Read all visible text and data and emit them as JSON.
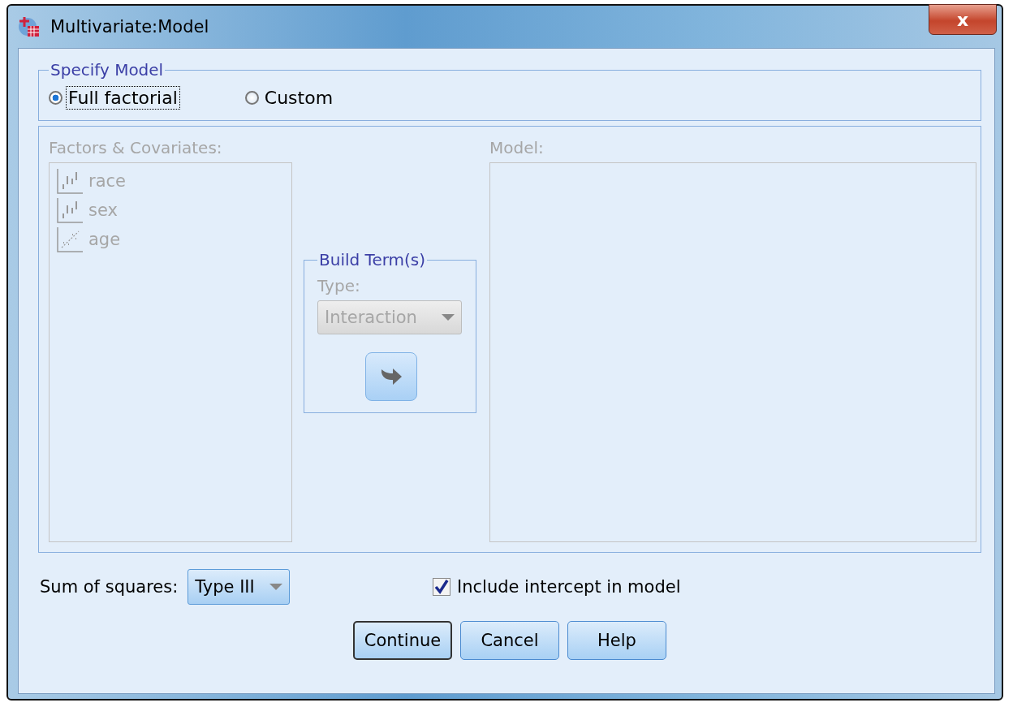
{
  "window": {
    "title": "Multivariate:Model",
    "close": "x"
  },
  "specify_model": {
    "title": "Specify Model",
    "options": [
      {
        "label": "Full factorial",
        "selected": true,
        "focused": true
      },
      {
        "label": "Custom",
        "selected": false,
        "focused": false
      }
    ]
  },
  "custom": {
    "disabled": true,
    "factors_label": "Factors & Covariates:",
    "factors": [
      {
        "name": "race",
        "kind": "nominal"
      },
      {
        "name": "sex",
        "kind": "nominal"
      },
      {
        "name": "age",
        "kind": "scale"
      }
    ],
    "build_terms": {
      "title": "Build Term(s)",
      "type_label": "Type:",
      "type_value": "Interaction"
    },
    "model_label": "Model:"
  },
  "sum_of_squares": {
    "label": "Sum of squares:",
    "value": "Type III"
  },
  "include_intercept": {
    "label": "Include intercept in model",
    "checked": true
  },
  "buttons": [
    {
      "label": "Continue",
      "default": true
    },
    {
      "label": "Cancel",
      "default": false
    },
    {
      "label": "Help",
      "default": false
    }
  ]
}
